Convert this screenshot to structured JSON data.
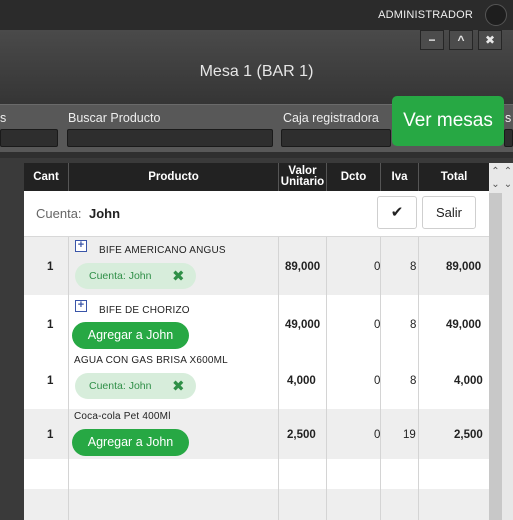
{
  "header": {
    "user_label": "ADMINISTRADOR",
    "window_title": "Mesa 1 (BAR 1)",
    "window_buttons": {
      "minimize": "−",
      "maximize": "^",
      "close": "✖"
    }
  },
  "filters": {
    "label_left_partial": "s",
    "buscar_producto": "Buscar Producto",
    "caja_registradora": "Caja registradora",
    "label_right_partial": "s"
  },
  "ver_mesas_label": "Ver mesas",
  "table": {
    "headers": {
      "cant": "Cant",
      "producto": "Producto",
      "valor_unitario_1": "Valor",
      "valor_unitario_2": "Unitario",
      "dcto": "Dcto",
      "iva": "Iva",
      "total": "Total"
    },
    "cuenta_label": "Cuenta:",
    "cuenta_name": "John",
    "check_icon": "✔",
    "salir_label": "Salir",
    "rows": [
      {
        "cant": "1",
        "producto": "BIFE AMERICANO ANGUS",
        "valor": "89,000",
        "dcto": "0",
        "iva": "8",
        "total": "89,000",
        "has_plus": true,
        "action": "pill",
        "pill_text": "Cuenta: John"
      },
      {
        "cant": "1",
        "producto": "BIFE DE CHORIZO",
        "valor": "49,000",
        "dcto": "0",
        "iva": "8",
        "total": "49,000",
        "has_plus": true,
        "action": "agregar",
        "agregar_text": "Agregar a John"
      },
      {
        "cant": "1",
        "producto": "AGUA CON GAS BRISA X600ML",
        "valor": "4,000",
        "dcto": "0",
        "iva": "8",
        "total": "4,000",
        "has_plus": false,
        "action": "pill",
        "pill_text": "Cuenta: John"
      },
      {
        "cant": "1",
        "producto": "Coca-cola Pet 400Ml",
        "valor": "2,500",
        "dcto": "0",
        "iva": "19",
        "total": "2,500",
        "has_plus": false,
        "action": "agregar",
        "agregar_text": "Agregar a John"
      }
    ]
  }
}
